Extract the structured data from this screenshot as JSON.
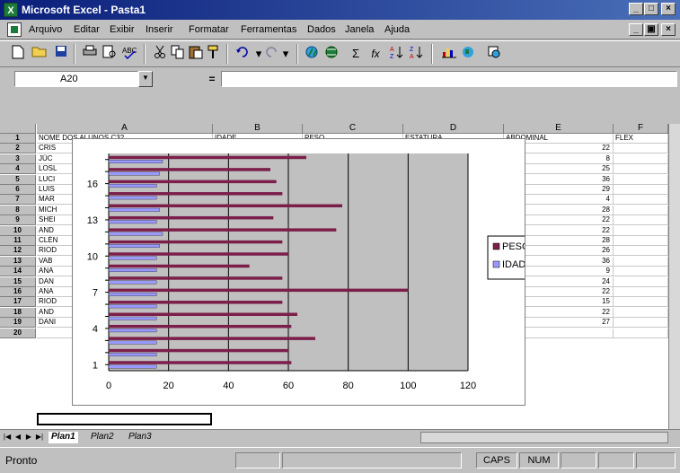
{
  "window": {
    "title": "Microsoft Excel - Pasta1",
    "minimize": "_",
    "maximize": "□",
    "close": "×",
    "doc_minimize": "_",
    "doc_restore": "▣",
    "doc_close": "×"
  },
  "menu": [
    "Arquivo",
    "Editar",
    "Exibir",
    "Inserir",
    "Formatar",
    "Ferramentas",
    "Dados",
    "Janela",
    "Ajuda"
  ],
  "toolbar": {
    "icons": [
      "new-icon",
      "open-icon",
      "save-icon",
      "print-icon",
      "print-preview-icon",
      "spelling-icon",
      "cut-icon",
      "copy-icon",
      "paste-icon",
      "format-painter-icon",
      "undo-icon",
      "redo-icon",
      "hyperlink-icon",
      "web-toolbar-icon",
      "autosum-icon",
      "function-icon",
      "sort-ascending-icon",
      "sort-descending-icon",
      "chart-wizard-icon",
      "map-icon",
      "drawing-icon"
    ],
    "autosum_glyph": "Σ",
    "function_glyph": "fx"
  },
  "formula": {
    "namebox": "A20",
    "eq": "=",
    "value": ""
  },
  "columns": [
    "A",
    "B",
    "C",
    "D",
    "E",
    "F"
  ],
  "headers": [
    "NOME DOS ALUNOS C32",
    "IDADE",
    "PESO",
    "ESTATURA",
    "ABDOMINAL",
    "FLEX"
  ],
  "rows": [
    {
      "n": "1"
    },
    {
      "n": "2",
      "name": "CRIS",
      "abd": "22"
    },
    {
      "n": "3",
      "name": "JÚC",
      "abd": "8"
    },
    {
      "n": "4",
      "name": "LOSL",
      "abd": "25"
    },
    {
      "n": "5",
      "name": "LUCI",
      "abd": "36"
    },
    {
      "n": "6",
      "name": "LUIS",
      "abd": "29"
    },
    {
      "n": "7",
      "name": "MAR",
      "abd": "4"
    },
    {
      "n": "8",
      "name": "MICH",
      "abd": "28"
    },
    {
      "n": "9",
      "name": "SHEI",
      "abd": "22"
    },
    {
      "n": "10",
      "name": "AND",
      "abd": "22"
    },
    {
      "n": "11",
      "name": "CLÉN",
      "abd": "28"
    },
    {
      "n": "12",
      "name": "RIOD",
      "abd": "26"
    },
    {
      "n": "13",
      "name": "VAB",
      "abd": "36"
    },
    {
      "n": "14",
      "name": "ANA",
      "abd": "9"
    },
    {
      "n": "15",
      "name": "DAN",
      "abd": "24"
    },
    {
      "n": "16",
      "name": "ANA",
      "abd": "22"
    },
    {
      "n": "17",
      "name": "RIOD",
      "abd": "15"
    },
    {
      "n": "18",
      "name": "AND",
      "abd": "22"
    },
    {
      "n": "19",
      "name": "DANI",
      "abd": "27"
    },
    {
      "n": "20"
    }
  ],
  "chart_data": {
    "type": "bar",
    "orientation": "horizontal",
    "categories": [
      "1",
      "2",
      "3",
      "4",
      "5",
      "6",
      "7",
      "8",
      "9",
      "10",
      "11",
      "12",
      "13",
      "14",
      "15",
      "16",
      "17",
      "18"
    ],
    "y_tick_labels": [
      "1",
      "4",
      "7",
      "10",
      "13",
      "16"
    ],
    "x_ticks": [
      "0",
      "20",
      "40",
      "60",
      "80",
      "100",
      "120"
    ],
    "xlim": [
      0,
      120
    ],
    "series": [
      {
        "name": "PESO",
        "color": "#7b1f4a",
        "values": [
          61,
          60,
          69,
          61,
          63,
          58,
          100,
          58,
          47,
          60,
          58,
          76,
          55,
          78,
          58,
          56,
          54,
          66
        ]
      },
      {
        "name": "IDADE",
        "color": "#9999ff",
        "values": [
          16,
          16,
          16,
          16,
          16,
          16,
          16,
          16,
          16,
          16,
          17,
          18,
          16,
          17,
          16,
          16,
          17,
          18
        ]
      }
    ],
    "plot_background": "#c0c0c0",
    "grid": true,
    "legend": "right"
  },
  "sheets": [
    "Plan1",
    "Plan2",
    "Plan3"
  ],
  "status": {
    "text": "Pronto",
    "caps": "CAPS",
    "num": "NUM"
  }
}
